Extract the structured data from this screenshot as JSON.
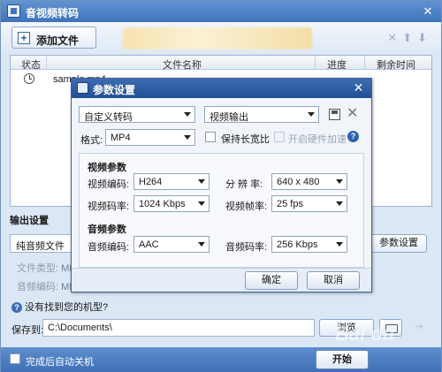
{
  "app": {
    "title": "音视频转码"
  },
  "toolbar": {
    "add_file_label": "添加文件"
  },
  "file_list": {
    "columns": [
      "状态",
      "文件名称",
      "进度",
      "剩余时间"
    ],
    "rows": [
      {
        "file_name": "sample.mp4"
      }
    ]
  },
  "output": {
    "section_label": "输出设置",
    "preset_value": "纯音频文件",
    "params_button_label": "参数设置",
    "file_type_label": "文件类型:",
    "file_type_value": "MP",
    "audio_codec_label": "音频编码:",
    "audio_codec_value": "MP",
    "model_question": "没有找到您的机型?",
    "save_to_label": "保存到:",
    "save_path": "C:\\Documents\\",
    "browse_label": "浏览"
  },
  "footer": {
    "auto_shutdown_label": "完成后自动关机",
    "start_label": "开始",
    "watermark": "Bai du"
  },
  "dialog": {
    "title": "参数设置",
    "preset_value": "自定义转码",
    "mode_value": "视频输出",
    "format_label": "格式:",
    "format_value": "MP4",
    "keep_aspect_label": "保持长宽比",
    "hw_accel_label": "开启硬件加速",
    "video_params_title": "视频参数",
    "video_codec_label": "视频编码:",
    "video_codec_value": "H264",
    "resolution_label": "分 辨 率:",
    "resolution_value": "640 x 480",
    "video_bitrate_label": "视频码率:",
    "video_bitrate_value": "1024 Kbps",
    "frame_rate_label": "视频帧率:",
    "frame_rate_value": "25 fps",
    "audio_params_title": "音频参数",
    "audio_codec_label": "音频编码:",
    "audio_codec_value": "AAC",
    "audio_bitrate_label": "音频码率:",
    "audio_bitrate_value": "256 Kbps",
    "ok_label": "确定",
    "cancel_label": "取消"
  }
}
